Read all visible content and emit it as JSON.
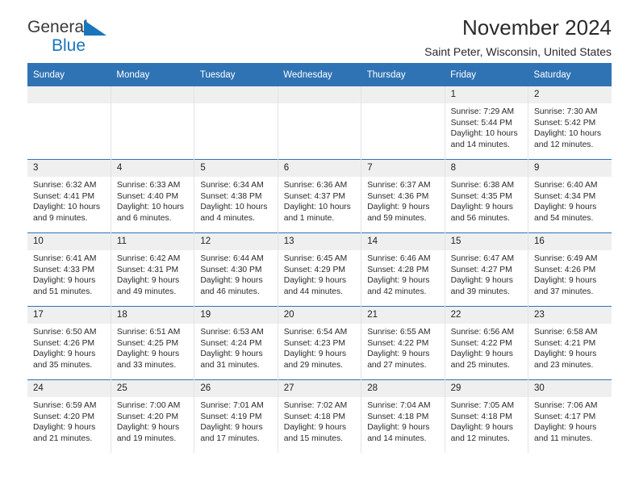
{
  "brand": {
    "line1": "General",
    "line2": "Blue",
    "accent_color": "#1a75bb"
  },
  "header": {
    "title": "November 2024",
    "subtitle": "Saint Peter, Wisconsin, United States"
  },
  "theme": {
    "header_blue": "#3073b4",
    "daynum_gray": "#efefef",
    "text": "#222222"
  },
  "calendar": {
    "weekdays": [
      "Sunday",
      "Monday",
      "Tuesday",
      "Wednesday",
      "Thursday",
      "Friday",
      "Saturday"
    ],
    "labels": {
      "sunrise": "Sunrise:",
      "sunset": "Sunset:",
      "daylight": "Daylight:"
    },
    "weeks": [
      [
        {
          "day": "",
          "sunrise": "",
          "sunset": "",
          "daylight1": "",
          "daylight2": ""
        },
        {
          "day": "",
          "sunrise": "",
          "sunset": "",
          "daylight1": "",
          "daylight2": ""
        },
        {
          "day": "",
          "sunrise": "",
          "sunset": "",
          "daylight1": "",
          "daylight2": ""
        },
        {
          "day": "",
          "sunrise": "",
          "sunset": "",
          "daylight1": "",
          "daylight2": ""
        },
        {
          "day": "",
          "sunrise": "",
          "sunset": "",
          "daylight1": "",
          "daylight2": ""
        },
        {
          "day": "1",
          "sunrise": "Sunrise: 7:29 AM",
          "sunset": "Sunset: 5:44 PM",
          "daylight1": "Daylight: 10 hours",
          "daylight2": "and 14 minutes."
        },
        {
          "day": "2",
          "sunrise": "Sunrise: 7:30 AM",
          "sunset": "Sunset: 5:42 PM",
          "daylight1": "Daylight: 10 hours",
          "daylight2": "and 12 minutes."
        }
      ],
      [
        {
          "day": "3",
          "sunrise": "Sunrise: 6:32 AM",
          "sunset": "Sunset: 4:41 PM",
          "daylight1": "Daylight: 10 hours",
          "daylight2": "and 9 minutes."
        },
        {
          "day": "4",
          "sunrise": "Sunrise: 6:33 AM",
          "sunset": "Sunset: 4:40 PM",
          "daylight1": "Daylight: 10 hours",
          "daylight2": "and 6 minutes."
        },
        {
          "day": "5",
          "sunrise": "Sunrise: 6:34 AM",
          "sunset": "Sunset: 4:38 PM",
          "daylight1": "Daylight: 10 hours",
          "daylight2": "and 4 minutes."
        },
        {
          "day": "6",
          "sunrise": "Sunrise: 6:36 AM",
          "sunset": "Sunset: 4:37 PM",
          "daylight1": "Daylight: 10 hours",
          "daylight2": "and 1 minute."
        },
        {
          "day": "7",
          "sunrise": "Sunrise: 6:37 AM",
          "sunset": "Sunset: 4:36 PM",
          "daylight1": "Daylight: 9 hours",
          "daylight2": "and 59 minutes."
        },
        {
          "day": "8",
          "sunrise": "Sunrise: 6:38 AM",
          "sunset": "Sunset: 4:35 PM",
          "daylight1": "Daylight: 9 hours",
          "daylight2": "and 56 minutes."
        },
        {
          "day": "9",
          "sunrise": "Sunrise: 6:40 AM",
          "sunset": "Sunset: 4:34 PM",
          "daylight1": "Daylight: 9 hours",
          "daylight2": "and 54 minutes."
        }
      ],
      [
        {
          "day": "10",
          "sunrise": "Sunrise: 6:41 AM",
          "sunset": "Sunset: 4:33 PM",
          "daylight1": "Daylight: 9 hours",
          "daylight2": "and 51 minutes."
        },
        {
          "day": "11",
          "sunrise": "Sunrise: 6:42 AM",
          "sunset": "Sunset: 4:31 PM",
          "daylight1": "Daylight: 9 hours",
          "daylight2": "and 49 minutes."
        },
        {
          "day": "12",
          "sunrise": "Sunrise: 6:44 AM",
          "sunset": "Sunset: 4:30 PM",
          "daylight1": "Daylight: 9 hours",
          "daylight2": "and 46 minutes."
        },
        {
          "day": "13",
          "sunrise": "Sunrise: 6:45 AM",
          "sunset": "Sunset: 4:29 PM",
          "daylight1": "Daylight: 9 hours",
          "daylight2": "and 44 minutes."
        },
        {
          "day": "14",
          "sunrise": "Sunrise: 6:46 AM",
          "sunset": "Sunset: 4:28 PM",
          "daylight1": "Daylight: 9 hours",
          "daylight2": "and 42 minutes."
        },
        {
          "day": "15",
          "sunrise": "Sunrise: 6:47 AM",
          "sunset": "Sunset: 4:27 PM",
          "daylight1": "Daylight: 9 hours",
          "daylight2": "and 39 minutes."
        },
        {
          "day": "16",
          "sunrise": "Sunrise: 6:49 AM",
          "sunset": "Sunset: 4:26 PM",
          "daylight1": "Daylight: 9 hours",
          "daylight2": "and 37 minutes."
        }
      ],
      [
        {
          "day": "17",
          "sunrise": "Sunrise: 6:50 AM",
          "sunset": "Sunset: 4:26 PM",
          "daylight1": "Daylight: 9 hours",
          "daylight2": "and 35 minutes."
        },
        {
          "day": "18",
          "sunrise": "Sunrise: 6:51 AM",
          "sunset": "Sunset: 4:25 PM",
          "daylight1": "Daylight: 9 hours",
          "daylight2": "and 33 minutes."
        },
        {
          "day": "19",
          "sunrise": "Sunrise: 6:53 AM",
          "sunset": "Sunset: 4:24 PM",
          "daylight1": "Daylight: 9 hours",
          "daylight2": "and 31 minutes."
        },
        {
          "day": "20",
          "sunrise": "Sunrise: 6:54 AM",
          "sunset": "Sunset: 4:23 PM",
          "daylight1": "Daylight: 9 hours",
          "daylight2": "and 29 minutes."
        },
        {
          "day": "21",
          "sunrise": "Sunrise: 6:55 AM",
          "sunset": "Sunset: 4:22 PM",
          "daylight1": "Daylight: 9 hours",
          "daylight2": "and 27 minutes."
        },
        {
          "day": "22",
          "sunrise": "Sunrise: 6:56 AM",
          "sunset": "Sunset: 4:22 PM",
          "daylight1": "Daylight: 9 hours",
          "daylight2": "and 25 minutes."
        },
        {
          "day": "23",
          "sunrise": "Sunrise: 6:58 AM",
          "sunset": "Sunset: 4:21 PM",
          "daylight1": "Daylight: 9 hours",
          "daylight2": "and 23 minutes."
        }
      ],
      [
        {
          "day": "24",
          "sunrise": "Sunrise: 6:59 AM",
          "sunset": "Sunset: 4:20 PM",
          "daylight1": "Daylight: 9 hours",
          "daylight2": "and 21 minutes."
        },
        {
          "day": "25",
          "sunrise": "Sunrise: 7:00 AM",
          "sunset": "Sunset: 4:20 PM",
          "daylight1": "Daylight: 9 hours",
          "daylight2": "and 19 minutes."
        },
        {
          "day": "26",
          "sunrise": "Sunrise: 7:01 AM",
          "sunset": "Sunset: 4:19 PM",
          "daylight1": "Daylight: 9 hours",
          "daylight2": "and 17 minutes."
        },
        {
          "day": "27",
          "sunrise": "Sunrise: 7:02 AM",
          "sunset": "Sunset: 4:18 PM",
          "daylight1": "Daylight: 9 hours",
          "daylight2": "and 15 minutes."
        },
        {
          "day": "28",
          "sunrise": "Sunrise: 7:04 AM",
          "sunset": "Sunset: 4:18 PM",
          "daylight1": "Daylight: 9 hours",
          "daylight2": "and 14 minutes."
        },
        {
          "day": "29",
          "sunrise": "Sunrise: 7:05 AM",
          "sunset": "Sunset: 4:18 PM",
          "daylight1": "Daylight: 9 hours",
          "daylight2": "and 12 minutes."
        },
        {
          "day": "30",
          "sunrise": "Sunrise: 7:06 AM",
          "sunset": "Sunset: 4:17 PM",
          "daylight1": "Daylight: 9 hours",
          "daylight2": "and 11 minutes."
        }
      ]
    ]
  }
}
